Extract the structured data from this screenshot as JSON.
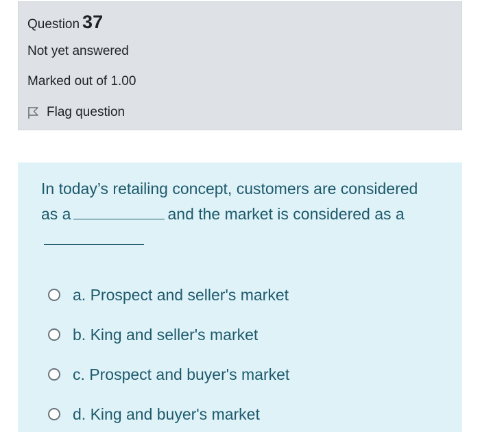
{
  "question": {
    "label": "Question",
    "number": "37",
    "state": "Not yet answered",
    "grade": "Marked out of 1.00",
    "flag_label": "Flag question"
  },
  "prompt": {
    "part1": "In today’s retailing concept, customers are considered as a",
    "part2": "and the market is considered as a"
  },
  "options": [
    {
      "label": "a. Prospect and seller's market",
      "selected": false
    },
    {
      "label": "b. King and seller's market",
      "selected": false
    },
    {
      "label": "c. Prospect and buyer's market",
      "selected": false
    },
    {
      "label": "d. King and buyer's market",
      "selected": false
    }
  ],
  "colors": {
    "info_background": "#dee2e6",
    "content_background": "#def2f8",
    "question_text": "#1e5a6b"
  },
  "icons": {
    "flag": "flag-icon"
  }
}
